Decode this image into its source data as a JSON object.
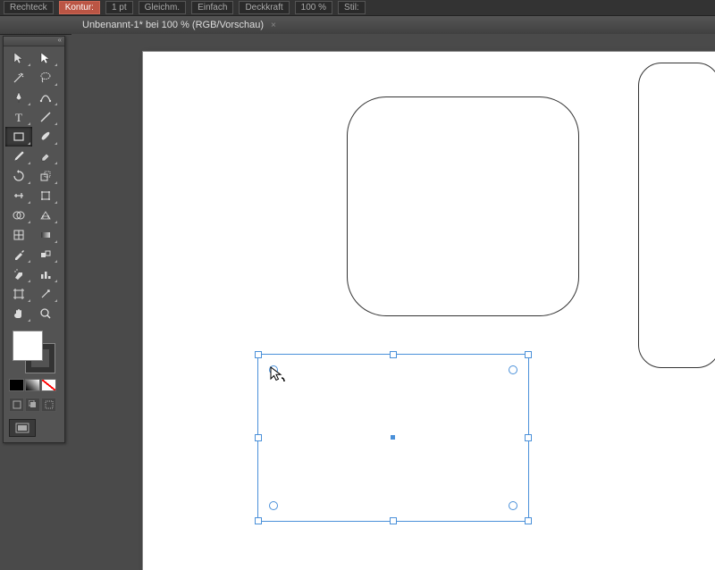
{
  "topbar": {
    "t1": "Rechteck",
    "t2": "Kontur:",
    "t3": "1 pt",
    "t4": "Gleichm.",
    "t5": "Einfach",
    "t6": "Deckkraft",
    "t7": "100 %",
    "t8": "Stil:"
  },
  "tab": {
    "title": "Unbenannt-1* bei 100 % (RGB/Vorschau)",
    "close": "×"
  },
  "toolbox": {
    "collapse": "«"
  }
}
